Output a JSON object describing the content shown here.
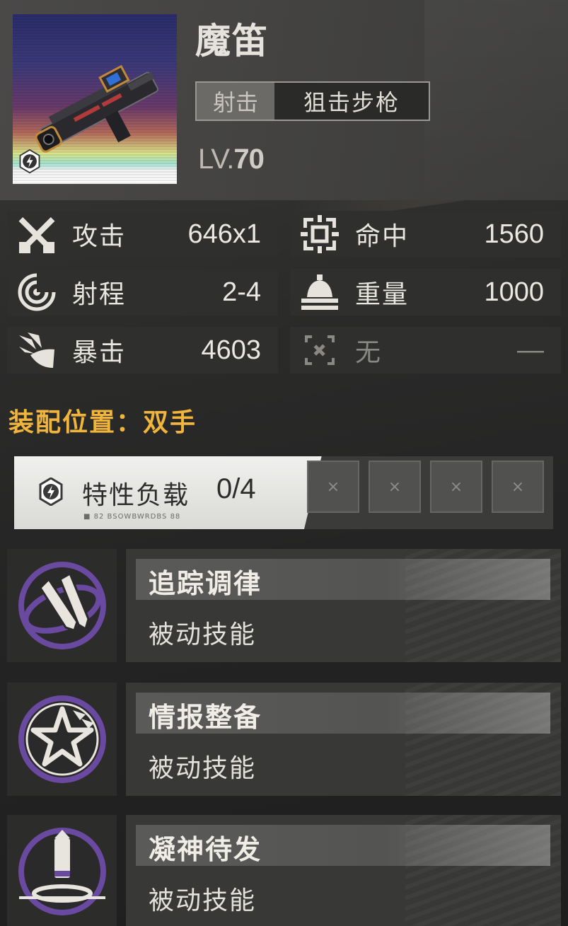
{
  "weapon": {
    "name": "魔笛",
    "category": "射击",
    "subtype": "狙击步枪",
    "level_prefix": "LV.",
    "level_value": "70"
  },
  "stats": [
    {
      "icon": "crossed-swords-icon",
      "label": "攻击",
      "value": "646x1"
    },
    {
      "icon": "target-reticle-icon",
      "label": "命中",
      "value": "1560"
    },
    {
      "icon": "range-radar-icon",
      "label": "射程",
      "value": "2-4"
    },
    {
      "icon": "weight-bell-icon",
      "label": "重量",
      "value": "1000"
    },
    {
      "icon": "critical-burst-icon",
      "label": "暴击",
      "value": "4603"
    },
    {
      "icon": "empty-reticle-icon",
      "label": "无",
      "value": "—"
    }
  ],
  "equip_position": "装配位置：双手",
  "trait": {
    "label": "特性负载",
    "count": "0/4",
    "sub_text": "■ 82 BSOWBWRDBS 88",
    "slots": [
      "×",
      "×",
      "×",
      "×"
    ]
  },
  "skills": [
    {
      "name": "追踪调律",
      "type": "被动技能",
      "icon": "bullets-orbit-icon"
    },
    {
      "name": "情报整备",
      "type": "被动技能",
      "icon": "star-chevron-icon"
    },
    {
      "name": "凝神待发",
      "type": "被动技能",
      "icon": "bullet-launch-icon"
    }
  ],
  "colors": {
    "accent_gold": "#f1b53b",
    "skill_purple": "#6a4aa0",
    "panel_bg": "#383837"
  }
}
